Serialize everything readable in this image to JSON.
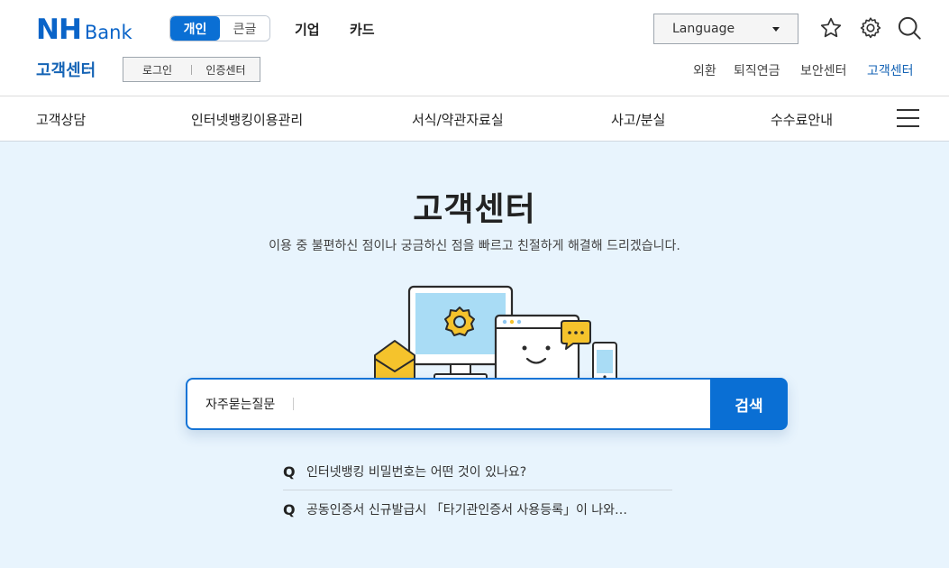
{
  "header": {
    "logo_main": "NH",
    "logo_sub": "Bank",
    "mode_active": "개인",
    "mode_inactive": "큰글",
    "menu": [
      "기업",
      "카드"
    ],
    "language_label": "Language",
    "icons": [
      "star-icon",
      "gear-icon",
      "search-icon"
    ]
  },
  "subheader": {
    "title": "고객센터",
    "auth": [
      "로그인",
      "인증센터"
    ],
    "util_links": [
      "외환",
      "퇴직연금",
      "보안센터",
      "고객센터"
    ]
  },
  "gnb": {
    "items": [
      "고객상담",
      "인터넷뱅킹이용관리",
      "서식/약관자료실",
      "사고/분실",
      "수수료안내"
    ]
  },
  "hero": {
    "title": "고객센터",
    "subtitle": "이용 중 불편하신 점이나 궁금하신 점을 빠르고 친절하게 해결해 드리겠습니다."
  },
  "search": {
    "category": "자주묻는질문",
    "button_label": "검색",
    "value": ""
  },
  "faq": [
    {
      "marker": "Q",
      "text": "인터넷뱅킹 비밀번호는 어떤 것이 있나요?"
    },
    {
      "marker": "Q",
      "text": "공동인증서 신규발급시 「타기관인증서 사용등록」이 나와…"
    }
  ],
  "colors": {
    "brand": "#0a64c8",
    "button": "#0a6fd4",
    "hero_bg": "#e8f4fd",
    "active_link": "#1463b5"
  }
}
